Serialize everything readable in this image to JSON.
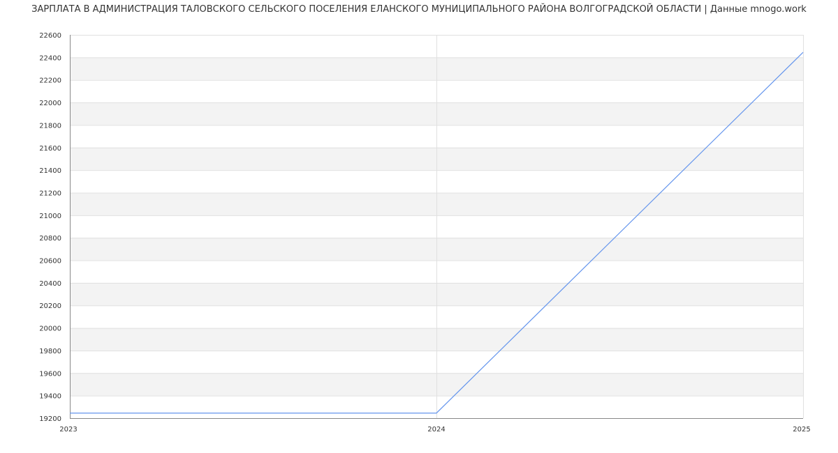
{
  "chart_data": {
    "type": "line",
    "title": "ЗАРПЛАТА В АДМИНИСТРАЦИЯ ТАЛОВСКОГО СЕЛЬСКОГО ПОСЕЛЕНИЯ ЕЛАНСКОГО МУНИЦИПАЛЬНОГО РАЙОНА ВОЛГОГРАДСКОЙ ОБЛАСТИ | Данные mnogo.work",
    "xlabel": "",
    "ylabel": "",
    "x": [
      "2023",
      "2024",
      "2025"
    ],
    "series": [
      {
        "values": [
          19245,
          19245,
          22445
        ],
        "color": "#6495ed"
      }
    ],
    "ylim": [
      19200,
      22600
    ],
    "yticks": [
      19200,
      19400,
      19600,
      19800,
      20000,
      20200,
      20400,
      20600,
      20800,
      21000,
      21200,
      21400,
      21600,
      21800,
      22000,
      22200,
      22400,
      22600
    ],
    "grid": true,
    "band_color": "#f3f3f3",
    "grid_color": "#e0e0e0",
    "axis_color": "#888888"
  }
}
